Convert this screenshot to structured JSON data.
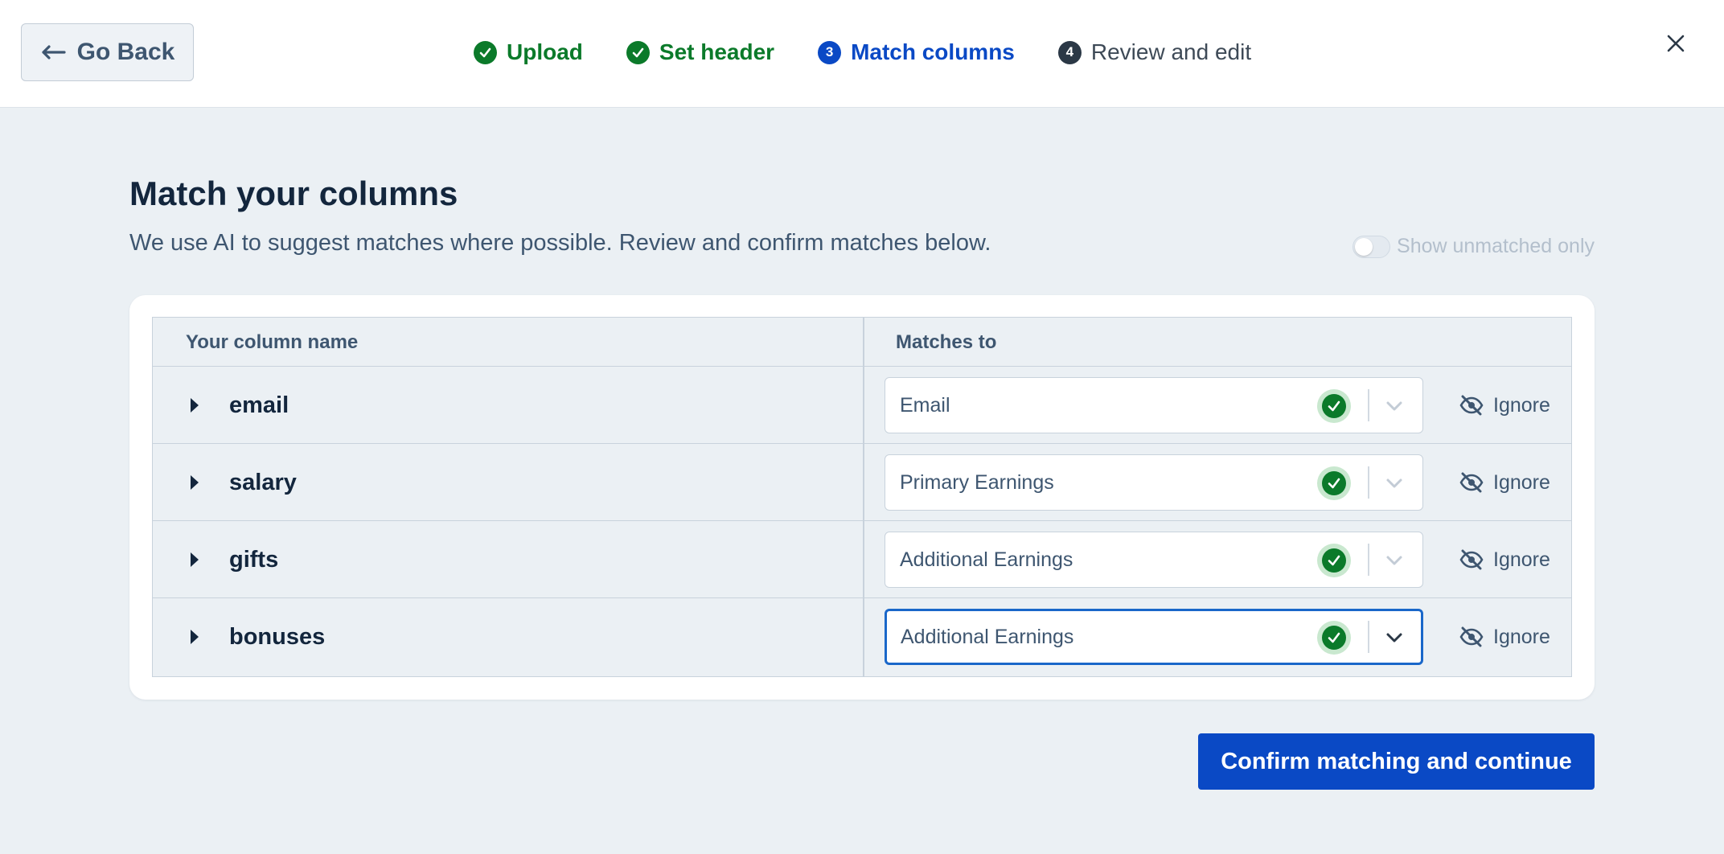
{
  "header": {
    "back_label": "Go Back",
    "steps": [
      {
        "label": "Upload",
        "status": "done",
        "marker": "✓"
      },
      {
        "label": "Set header",
        "status": "done",
        "marker": "✓"
      },
      {
        "label": "Match columns",
        "status": "active",
        "marker": "3"
      },
      {
        "label": "Review and edit",
        "status": "todo",
        "marker": "4"
      }
    ],
    "close_icon": "close-icon"
  },
  "main": {
    "title": "Match your columns",
    "subtitle": "We use AI to suggest matches where possible. Review and confirm matches below.",
    "toggle_label": "Show unmatched only",
    "toggle_on": false,
    "table": {
      "col_your_name": "Your column name",
      "col_matches_to": "Matches to",
      "rows": [
        {
          "name": "email",
          "match": "Email",
          "ignore_label": "Ignore"
        },
        {
          "name": "salary",
          "match": "Primary Earnings",
          "ignore_label": "Ignore"
        },
        {
          "name": "gifts",
          "match": "Additional Earnings",
          "ignore_label": "Ignore"
        },
        {
          "name": "bonuses",
          "match": "Additional Earnings",
          "ignore_label": "Ignore"
        }
      ]
    },
    "confirm_label": "Confirm matching and continue"
  },
  "colors": {
    "done": "#0b7a2a",
    "active": "#0a49c5",
    "primary_button": "#0a49c5",
    "background": "#ebf0f4"
  }
}
